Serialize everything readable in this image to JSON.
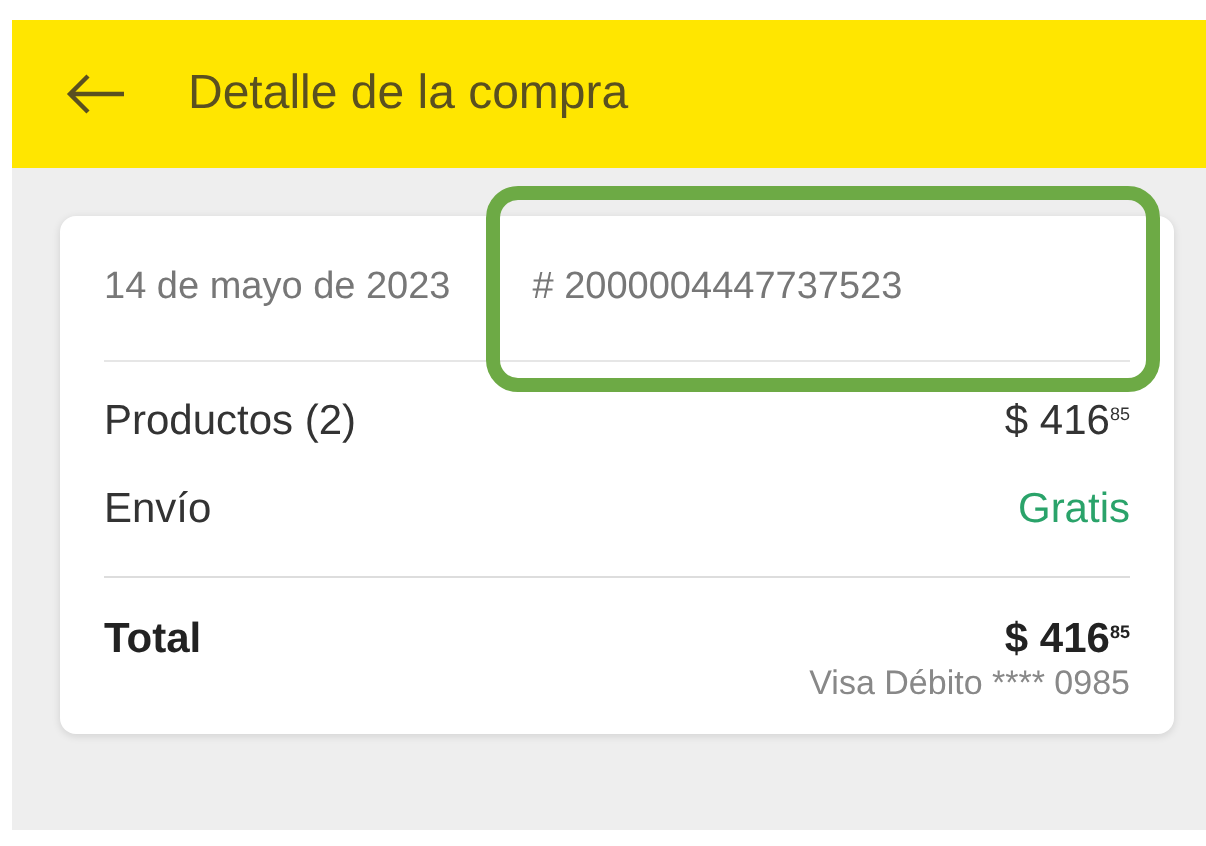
{
  "header": {
    "title": "Detalle de la compra"
  },
  "order": {
    "date": "14 de mayo de 2023",
    "number": "# 2000004447737523"
  },
  "lines": [
    {
      "label": "Productos (2)",
      "amount": "$ 416$^{85}$",
      "kind": "price"
    },
    {
      "label": "Envío",
      "amount": "Gratis",
      "kind": "free"
    }
  ],
  "total": {
    "label": "Total",
    "amount": "$ 416$^{85}$",
    "payment": "Visa Débito **** 0985"
  }
}
